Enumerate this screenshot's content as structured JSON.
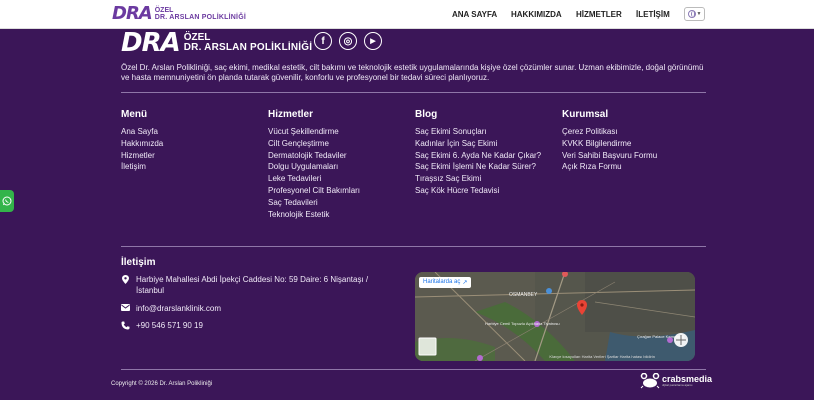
{
  "header": {
    "logo_mark": "DRA",
    "logo_line1": "ÖZEL",
    "logo_line2": "DR. ARSLAN POLİKLİNİĞİ",
    "nav": [
      "ANA SAYFA",
      "HAKKIMIZDA",
      "HİZMETLER",
      "İLETİŞİM"
    ],
    "language_icon": "globe-icon"
  },
  "footer": {
    "logo_mark": "DRA",
    "logo_line1": "ÖZEL",
    "logo_line2": "DR. ARSLAN POLİKLİNİĞİ",
    "social": [
      {
        "icon": "facebook-icon",
        "glyph": "f"
      },
      {
        "icon": "instagram-icon",
        "glyph": "◎"
      },
      {
        "icon": "youtube-icon",
        "glyph": "▶"
      }
    ],
    "description": "Özel Dr. Arslan Polikliniği, saç ekimi, medikal estetik, cilt bakımı ve teknolojik estetik uygulamalarında kişiye özel çözümler sunar. Uzman ekibimizle, doğal görünümü ve hasta memnuniyetini ön planda tutarak güvenilir, konforlu ve profesyonel bir tedavi süreci planlıyoruz.",
    "columns": [
      {
        "title": "Menü",
        "items": [
          "Ana Sayfa",
          "Hakkımızda",
          "Hizmetler",
          "İletişim"
        ]
      },
      {
        "title": "Hizmetler",
        "items": [
          "Vücut Şekillendirme",
          "Cilt Gençleştirme",
          "Dermatolojik Tedaviler",
          "Dolgu Uygulamaları",
          "Leke Tedavileri",
          "Profesyonel Cilt Bakımları",
          "Saç Tedavileri",
          "Teknolojik Estetik"
        ]
      },
      {
        "title": "Blog",
        "items": [
          "Saç Ekimi Sonuçları",
          "Kadınlar İçin Saç Ekimi",
          "Saç Ekimi 6. Ayda Ne Kadar Çıkar?",
          "Saç Ekimi İşlemi Ne Kadar Sürer?",
          "Tıraşsız Saç Ekimi",
          "Saç Kök Hücre Tedavisi"
        ]
      },
      {
        "title": "Kurumsal",
        "items": [
          "Çerez Politikası",
          "KVKK Bilgilendirme",
          "Veri Sahibi Başvuru Formu",
          "Açık Rıza Formu"
        ]
      }
    ],
    "contact": {
      "title": "İletişim",
      "address": "Harbiye Mahallesi Abdi İpekçi Caddesi No: 59 Daire: 6 Nişantaşı / İstanbul",
      "email": "info@drarslanklinik.com",
      "phone": "+90 546 571 90 19"
    },
    "map": {
      "open_label": "Haritalarda aç",
      "labels": [
        "OSMANBEY",
        "Harbiye Cemil Topuzlu Açıkhava Tiyatrosu",
        "Çırağan Palace Kempinski"
      ],
      "attribution": "Klavye kısayolları  Harita Verileri  Şartlar  Harita hatası bildirin"
    },
    "copyright": "Copyright © 2026 Dr. Arslan Polikliniği",
    "credit_brand": "crabsmedia",
    "credit_tagline": "dijital pazarlama ajansı"
  },
  "colors": {
    "background": "#3b1658",
    "brand": "#6b3aa0",
    "whatsapp": "#33b44a"
  }
}
